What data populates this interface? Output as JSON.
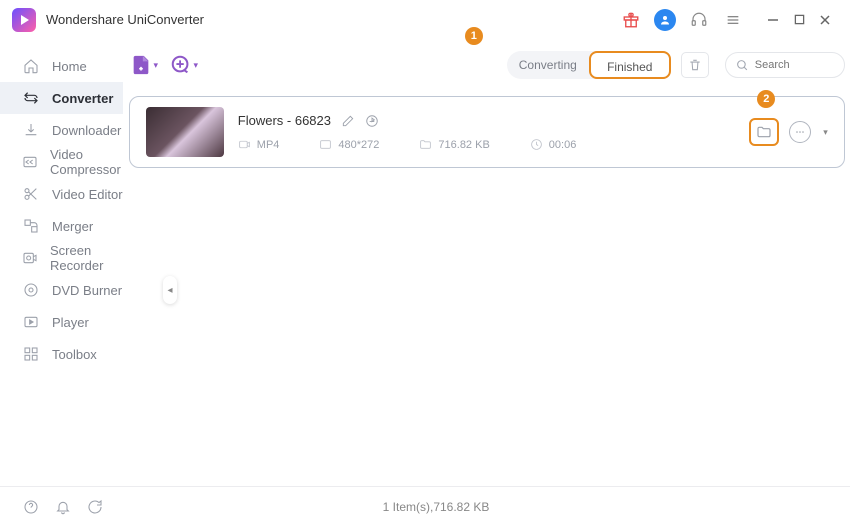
{
  "app": {
    "title": "Wondershare UniConverter"
  },
  "sidebar": {
    "items": [
      {
        "label": "Home"
      },
      {
        "label": "Converter"
      },
      {
        "label": "Downloader"
      },
      {
        "label": "Video Compressor"
      },
      {
        "label": "Video Editor"
      },
      {
        "label": "Merger"
      },
      {
        "label": "Screen Recorder"
      },
      {
        "label": "DVD Burner"
      },
      {
        "label": "Player"
      },
      {
        "label": "Toolbox"
      }
    ]
  },
  "tabs": {
    "converting": "Converting",
    "finished": "Finished"
  },
  "search": {
    "placeholder": "Search"
  },
  "callouts": {
    "one": "1",
    "two": "2"
  },
  "file": {
    "name": "Flowers - 66823",
    "format": "MP4",
    "resolution": "480*272",
    "size": "716.82 KB",
    "duration": "00:06"
  },
  "status": {
    "summary": "1 Item(s),716.82 KB"
  }
}
